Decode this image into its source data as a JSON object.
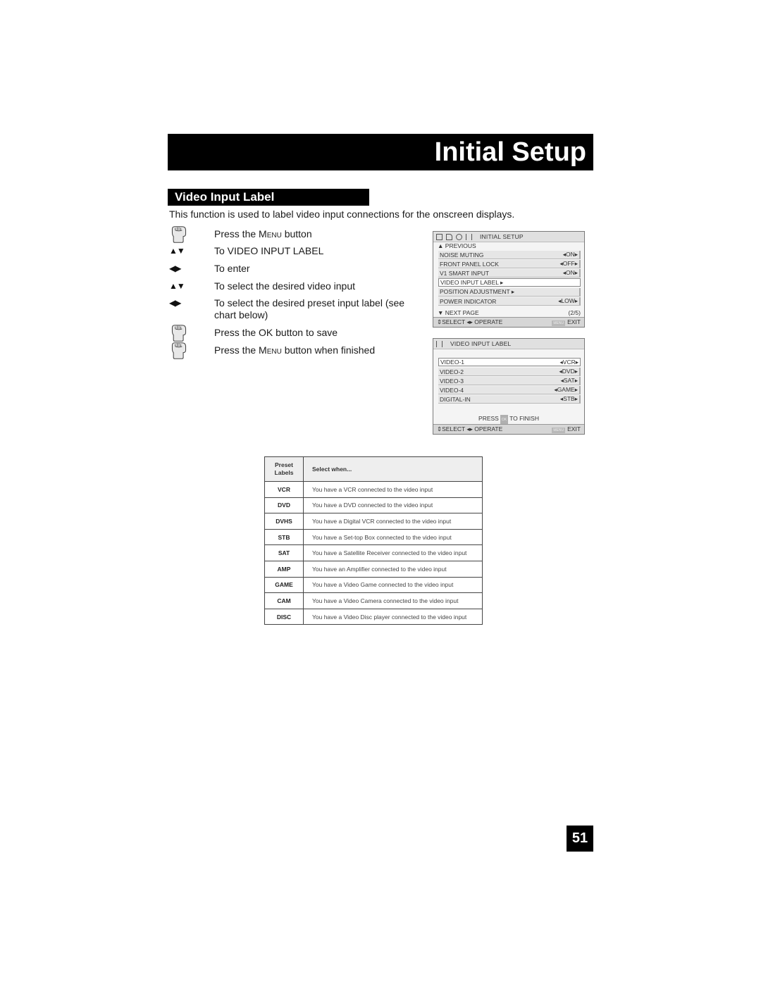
{
  "header": {
    "title": "Initial Setup"
  },
  "section": {
    "heading": "Video Input Label",
    "intro": "This function is used to label video input connections for the onscreen displays."
  },
  "steps": [
    {
      "icon": "hand-press-icon",
      "text_pre": "Press the ",
      "text_sc": "Menu",
      "text_post": " button"
    },
    {
      "icon": "up-down-arrows-icon",
      "arrows": "▲▼",
      "text": "To VIDEO INPUT LABEL"
    },
    {
      "icon": "left-right-arrows-icon",
      "arrows": "◀▶",
      "text": "To enter"
    },
    {
      "icon": "up-down-arrows-icon",
      "arrows": "▲▼",
      "text": "To select the desired video input"
    },
    {
      "icon": "left-right-arrows-icon",
      "arrows": "◀▶",
      "text": "To select the desired preset input label (see chart below)"
    },
    {
      "icon": "hand-press-icon",
      "text": "Press the OK button to save"
    },
    {
      "icon": "hand-press-icon",
      "text_pre": "Press the ",
      "text_sc": "Menu",
      "text_post": " button when finished"
    }
  ],
  "osd_initial_setup": {
    "title": "INITIAL SETUP",
    "previous": "▲ PREVIOUS",
    "rows": [
      {
        "label": "NOISE MUTING",
        "value": "◂ON▸"
      },
      {
        "label": "FRONT PANEL LOCK",
        "value": "◂OFF▸"
      },
      {
        "label": "V1 SMART INPUT",
        "value": "◂ON▸"
      },
      {
        "label": "VIDEO INPUT LABEL ▸",
        "value": "",
        "selected": true
      },
      {
        "label": "POSITION ADJUSTMENT ▸",
        "value": ""
      },
      {
        "label": "POWER INDICATOR",
        "value": "◂LOW▸"
      }
    ],
    "next_page": "▼ NEXT PAGE",
    "page_indicator": "(2/5)",
    "footer_left": "⇕SELECT ◂▸ OPERATE",
    "footer_menu_badge": "MENU",
    "footer_right": "EXIT"
  },
  "osd_video_input_label": {
    "title": "VIDEO INPUT LABEL",
    "rows": [
      {
        "label": "VIDEO-1",
        "value": "◂VCR▸",
        "selected": true
      },
      {
        "label": "VIDEO-2",
        "value": "◂DVD▸"
      },
      {
        "label": "VIDEO-3",
        "value": "◂SAT▸"
      },
      {
        "label": "VIDEO-4",
        "value": "◂GAME▸"
      },
      {
        "label": "DIGITAL-IN",
        "value": "◂STB▸"
      }
    ],
    "finish_pre": "PRESS",
    "finish_badge": "OK",
    "finish_post": "TO FINISH",
    "footer_left": "⇕SELECT ◂▸ OPERATE",
    "footer_menu_badge": "MENU",
    "footer_right": "EXIT"
  },
  "preset_table": {
    "headers": [
      "Preset Labels",
      "Select when..."
    ],
    "rows": [
      [
        "VCR",
        "You have a VCR connected to the video input"
      ],
      [
        "DVD",
        "You have a DVD connected to the video input"
      ],
      [
        "DVHS",
        "You have a Digital VCR connected to the video input"
      ],
      [
        "STB",
        "You have a Set-top Box connected to the video input"
      ],
      [
        "SAT",
        "You have a Satellite Receiver connected to the video input"
      ],
      [
        "AMP",
        "You have an Amplifier connected to the video input"
      ],
      [
        "GAME",
        "You have a Video Game connected to the video input"
      ],
      [
        "CAM",
        "You have a Video Camera connected to the video input"
      ],
      [
        "DISC",
        "You have a Video Disc player connected to the video input"
      ]
    ]
  },
  "page_number": "51"
}
